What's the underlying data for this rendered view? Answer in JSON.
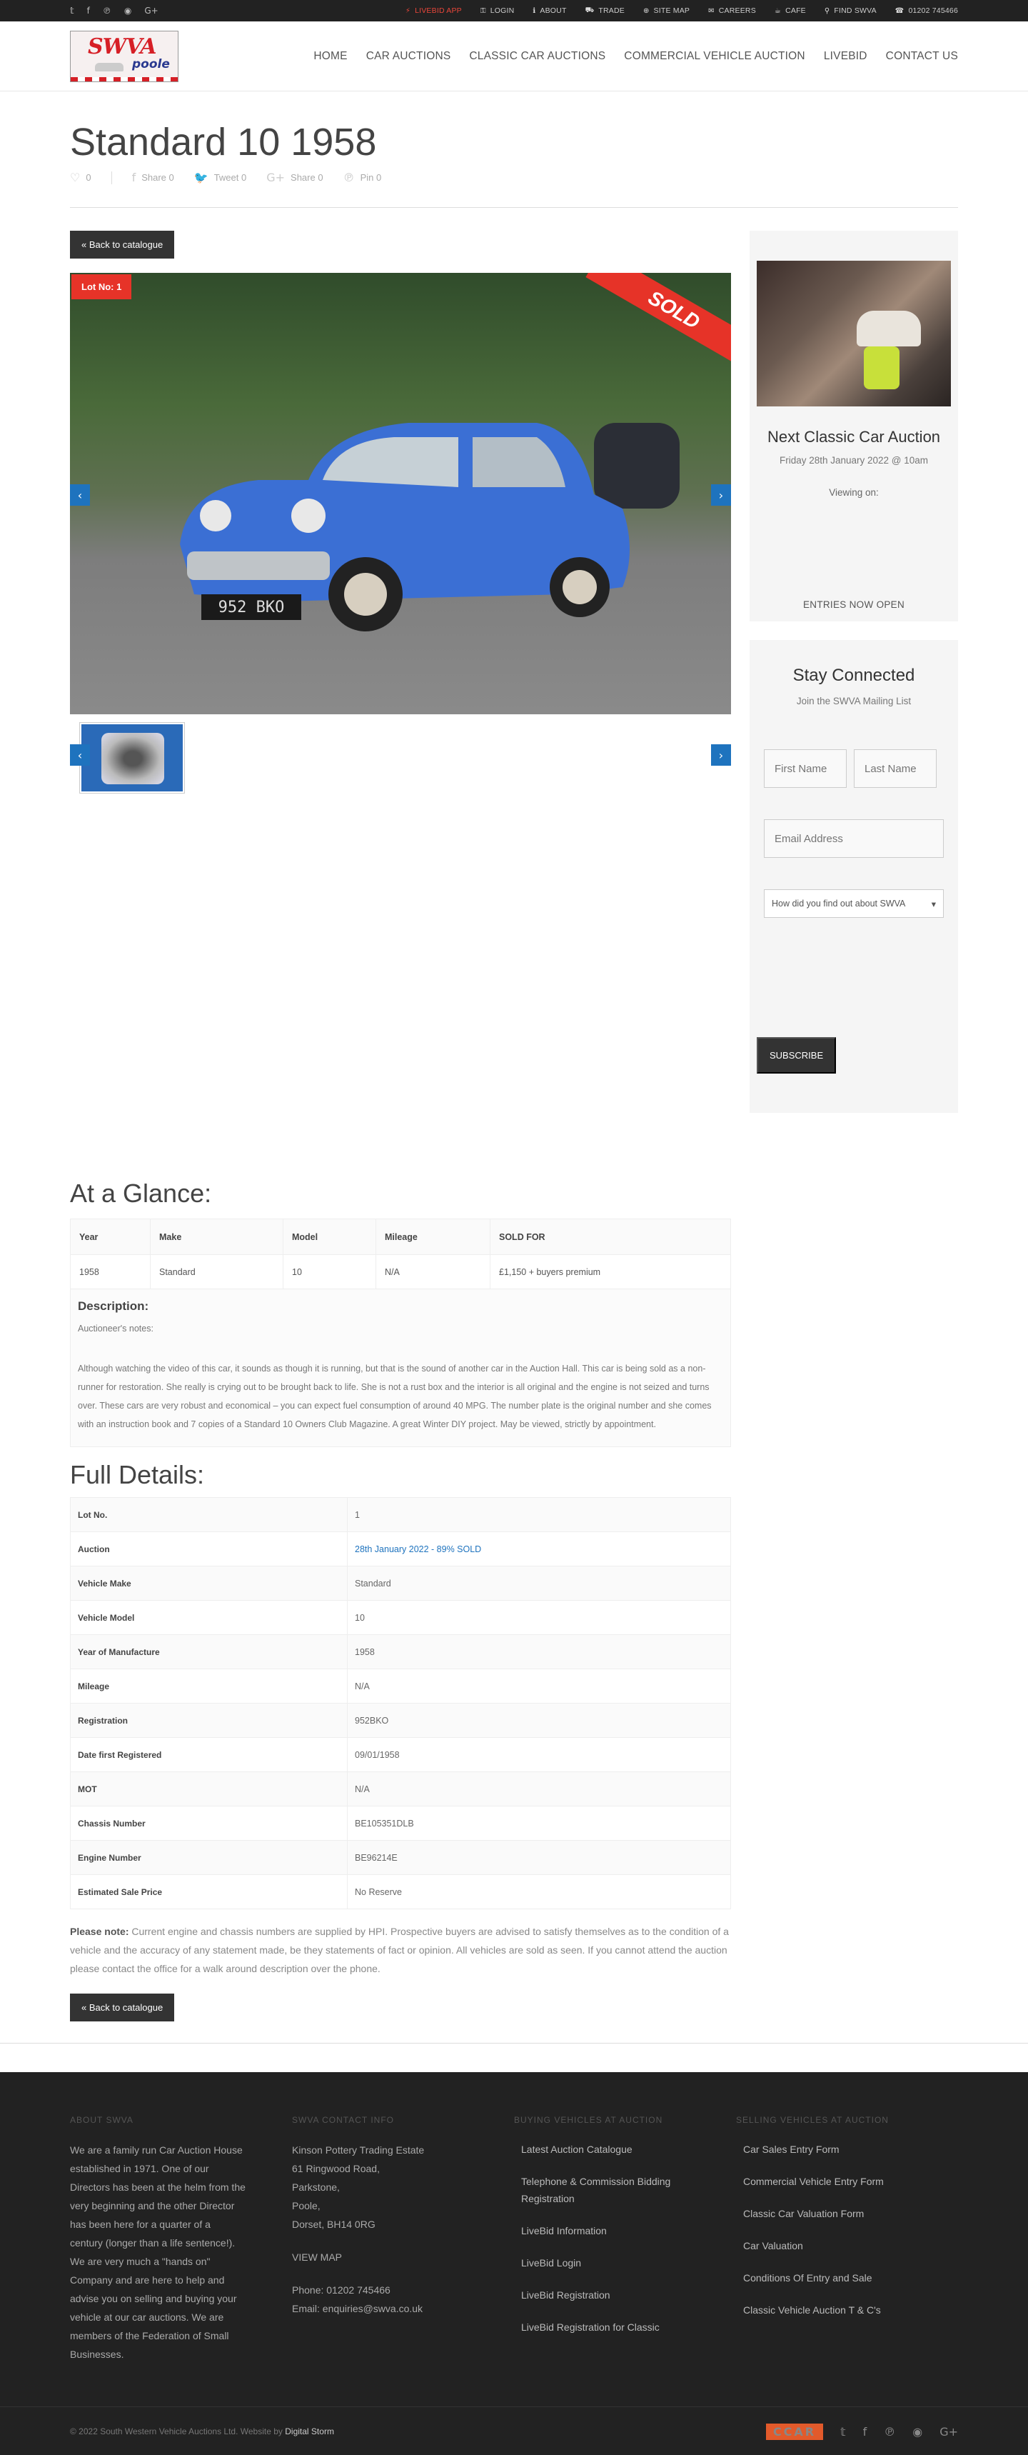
{
  "topbar": {
    "social": [
      "t",
      "f",
      "p",
      "rss",
      "G+"
    ],
    "links": [
      {
        "label": "LIVEBID APP",
        "icon": "⚡",
        "accent": true
      },
      {
        "label": "LOGIN",
        "icon": "🔑"
      },
      {
        "label": "ABOUT",
        "icon": "ℹ"
      },
      {
        "label": "TRADE",
        "icon": "🚗"
      },
      {
        "label": "SITE MAP",
        "icon": "⊕"
      },
      {
        "label": "CAREERS",
        "icon": "✉"
      },
      {
        "label": "CAFE",
        "icon": "☕"
      },
      {
        "label": "FIND SWVA",
        "icon": "📍"
      },
      {
        "label": "01202 745466",
        "icon": "📞"
      }
    ]
  },
  "logo": {
    "main": "SWVA",
    "sub": "poole"
  },
  "nav": [
    "HOME",
    "CAR AUCTIONS",
    "CLASSIC CAR AUCTIONS",
    "COMMERCIAL VEHICLE AUCTION",
    "LIVEBID",
    "CONTACT US"
  ],
  "page": {
    "title": "Standard 10 1958",
    "share": {
      "likes": "0",
      "facebook": "Share 0",
      "twitter": "Tweet 0",
      "gplus": "Share 0",
      "pinterest": "Pin 0"
    },
    "back_label": "« Back to catalogue",
    "lot_badge": "Lot No: 1",
    "sold": "SOLD",
    "plate": "952 BKO"
  },
  "sidebar": {
    "auction_title": "Next Classic Car Auction",
    "auction_date": "Friday 28th January 2022 @ 10am",
    "viewing": "Viewing on:",
    "entries": "ENTRIES NOW OPEN",
    "connect_title": "Stay Connected",
    "connect_sub": "Join the SWVA Mailing List",
    "first_name_ph": "First Name",
    "last_name_ph": "Last Name",
    "email_ph": "Email Address",
    "select_value": "How did you find out about SWVA",
    "subscribe": "SUBSCRIBE"
  },
  "glance": {
    "title": "At a Glance:",
    "headers": [
      "Year",
      "Make",
      "Model",
      "Mileage",
      "SOLD FOR"
    ],
    "row": [
      "1958",
      "Standard",
      "10",
      "N/A",
      "£1,150 + buyers premium"
    ],
    "desc_title": "Description:",
    "desc_note": "Auctioneer's notes:",
    "desc_text": "Although watching the video of this car, it sounds as though it is running, but that is the sound of another car in the Auction Hall.  This car is being sold as a non-runner for restoration.  She really is crying out to be brought back to life.  She is not a rust box and the interior is all original and the engine is not seized and turns over.  These cars are very robust and economical – you can expect fuel consumption of around 40 MPG.  The number plate is the original number and she comes with an instruction book and 7 copies of a Standard 10 Owners Club Magazine.  A great Winter DIY project.  May be viewed, strictly by appointment."
  },
  "details": {
    "title": "Full Details:",
    "rows": [
      {
        "k": "Lot No.",
        "v": "1"
      },
      {
        "k": "Auction",
        "v": "28th January 2022 - 89% SOLD",
        "link": true
      },
      {
        "k": "Vehicle Make",
        "v": "Standard"
      },
      {
        "k": "Vehicle Model",
        "v": "10"
      },
      {
        "k": "Year of Manufacture",
        "v": "1958"
      },
      {
        "k": "Mileage",
        "v": "N/A"
      },
      {
        "k": "Registration",
        "v": "952BKO"
      },
      {
        "k": "Date first Registered",
        "v": "09/01/1958"
      },
      {
        "k": "MOT",
        "v": "N/A"
      },
      {
        "k": "Chassis Number",
        "v": "BE105351DLB"
      },
      {
        "k": "Engine Number",
        "v": "BE96214E"
      },
      {
        "k": "Estimated Sale Price",
        "v": "No Reserve"
      }
    ],
    "note_label": "Please note:",
    "note_text": " Current engine and chassis numbers are supplied by HPI. Prospective buyers are advised to satisfy themselves as to the condition of a vehicle and the accuracy of any statement made, be they statements of fact or opinion. All vehicles are sold as seen. If you cannot attend the auction please contact the office for a walk around description over the phone."
  },
  "footer": {
    "about_title": "ABOUT SWVA",
    "about_text": "We are a family run Car Auction House established in 1971. One of our Directors has been at the helm from the very beginning and the other Director has been here for a quarter of a century (longer than a life sentence!). We are very much a \"hands on\" Company and are here to help and advise you on selling and buying your vehicle at our car auctions. We are members of the Federation of Small Businesses.",
    "contact_title": "SWVA CONTACT INFO",
    "address": [
      "Kinson Pottery Trading Estate",
      "61 Ringwood Road,",
      "Parkstone,",
      "Poole,",
      "Dorset, BH14 0RG"
    ],
    "view_map": "VIEW MAP",
    "phone": "Phone: 01202 745466",
    "email": "Email: enquiries@swva.co.uk",
    "buying_title": "BUYING VEHICLES AT AUCTION",
    "buying": [
      "Latest Auction Catalogue",
      "Telephone & Commission Bidding Registration",
      "LiveBid Information",
      "LiveBid Login",
      "LiveBid Registration",
      "LiveBid Registration for Classic"
    ],
    "selling_title": "SELLING VEHICLES AT AUCTION",
    "selling": [
      "Car Sales Entry Form",
      "Commercial Vehicle Entry Form",
      "Classic Car Valuation Form",
      "Car Valuation",
      "Conditions Of Entry and Sale",
      "Classic Vehicle Auction T & C's"
    ],
    "copyright": "© 2022 South Western Vehicle Auctions Ltd. Website by ",
    "credit": "Digital Storm",
    "badge": "CCAR"
  }
}
